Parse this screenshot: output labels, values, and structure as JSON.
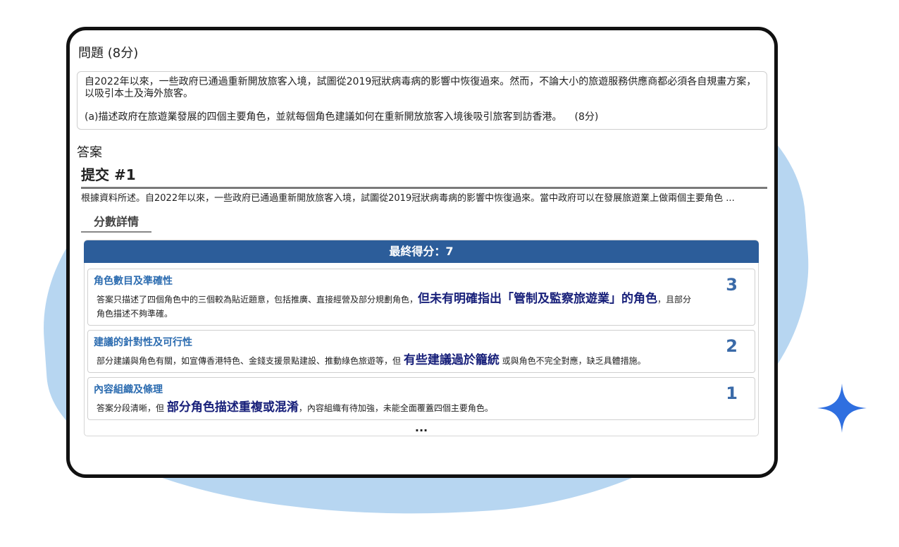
{
  "question": {
    "title": "問題 (8分)",
    "intro": "自2022年以來，一些政府已通過重新開放旅客入境，試圖從2019冠狀病毒病的影響中恢復過來。然而，不論大小的旅遊服務供應商都必須各自規畫方案，以吸引本土及海外旅客。",
    "part": "(a)描述政府在旅遊業發展的四個主要角色，並就每個角色建議如何在重新開放旅客入境後吸引旅客到訪香港。",
    "part_points": "(8分)"
  },
  "answer": {
    "label": "答案",
    "submission_title": "提交 #1",
    "submission_text": "根據資料所述。自2022年以來，一些政府已通過重新開放旅客入境，試圖從2019冠狀病毒病的影響中恢復過來。當中政府可以在發展旅遊業上做兩個主要角色 ..."
  },
  "score": {
    "tab_label": "分數詳情",
    "final_label": "最終得分：7",
    "criteria": [
      {
        "title": "角色數目及準確性",
        "text_before": "答案只描述了四個角色中的三個較為貼近題意，包括推廣、直接經營及部分規劃角色，",
        "highlight": "但未有明確指出「管制及監察旅遊業」的角色",
        "text_after": "，且部分角色描述不夠準確。",
        "score": "3"
      },
      {
        "title": "建議的針對性及可行性",
        "text_before": "部分建議與角色有關，如宣傳香港特色、金錢支援景點建設、推動綠色旅遊等，但 ",
        "highlight": "有些建議過於籠統",
        "text_after": " 或與角色不完全對應，缺乏具體措施。",
        "score": "2"
      },
      {
        "title": "內容組織及條理",
        "text_before": "答案分段清晰，但 ",
        "highlight": "部分角色描述重複或混淆",
        "text_after": "，內容組織有待加強，未能全面覆蓋四個主要角色。",
        "score": "1"
      }
    ],
    "more": "..."
  },
  "colors": {
    "accent": "#2c5d9a",
    "criterion_title": "#2c6cb0",
    "highlight": "#18207a",
    "blob": "#b7d6f1",
    "sparkle": "#2f6fe0"
  },
  "icons": {
    "sparkle": "sparkle-icon"
  }
}
